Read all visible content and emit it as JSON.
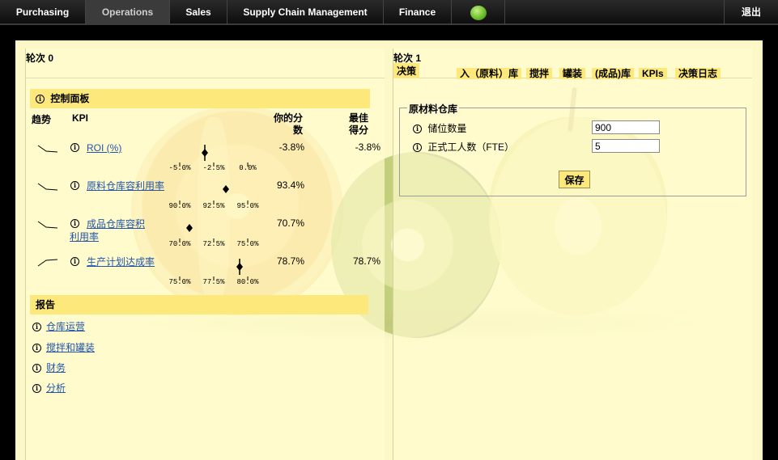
{
  "nav": {
    "items": [
      "Purchasing",
      "Operations",
      "Sales",
      "Supply Chain Management",
      "Finance"
    ],
    "active": "Operations",
    "logout_label": "退出"
  },
  "left": {
    "round_label": "轮次 0",
    "dashboard_title": "控制面板",
    "headers": {
      "trend": "趋势",
      "kpi": "KPI",
      "your_score": "你的分数",
      "best_score": "最佳得分"
    },
    "kpis": [
      {
        "label": "ROI (%)",
        "score": "-3.8%",
        "best": "-3.8%",
        "trend": "down",
        "scale_labels": [
          "-5.0%",
          "-2.5%",
          "0.0%"
        ]
      },
      {
        "label": "原料仓库容利用率",
        "score": "93.4%",
        "best": "",
        "trend": "down",
        "scale_labels": [
          "90.0%",
          "92.5%",
          "95.0%"
        ]
      },
      {
        "label": "成品仓库容积利用率",
        "score": "70.7%",
        "best": "",
        "trend": "down",
        "scale_labels": [
          "70.0%",
          "72.5%",
          "75.0%"
        ]
      },
      {
        "label": "生产计划达成率",
        "score": "78.7%",
        "best": "78.7%",
        "trend": "up",
        "scale_labels": [
          "75.0%",
          "77.5%",
          "80.0%"
        ]
      }
    ],
    "reports_title": "报告",
    "reports": [
      "仓库运营",
      "搅拌和罐装",
      "财务",
      "分析"
    ]
  },
  "right": {
    "round_label": "轮次 1",
    "decision_tab": "决策",
    "tabs": [
      "入（原料）库",
      "搅拌",
      "罐装",
      "(成品)库",
      "KPIs",
      "决策日志"
    ],
    "section_title": "原材料仓库",
    "fields": [
      {
        "label": "储位数量",
        "value": "900"
      },
      {
        "label": "正式工人数（FTE）",
        "value": "5"
      }
    ],
    "save_label": "保存"
  },
  "colors": {
    "accent": "#fde87c",
    "background": "#fdf8c8",
    "link": "#2255aa",
    "nav": "#111111"
  }
}
